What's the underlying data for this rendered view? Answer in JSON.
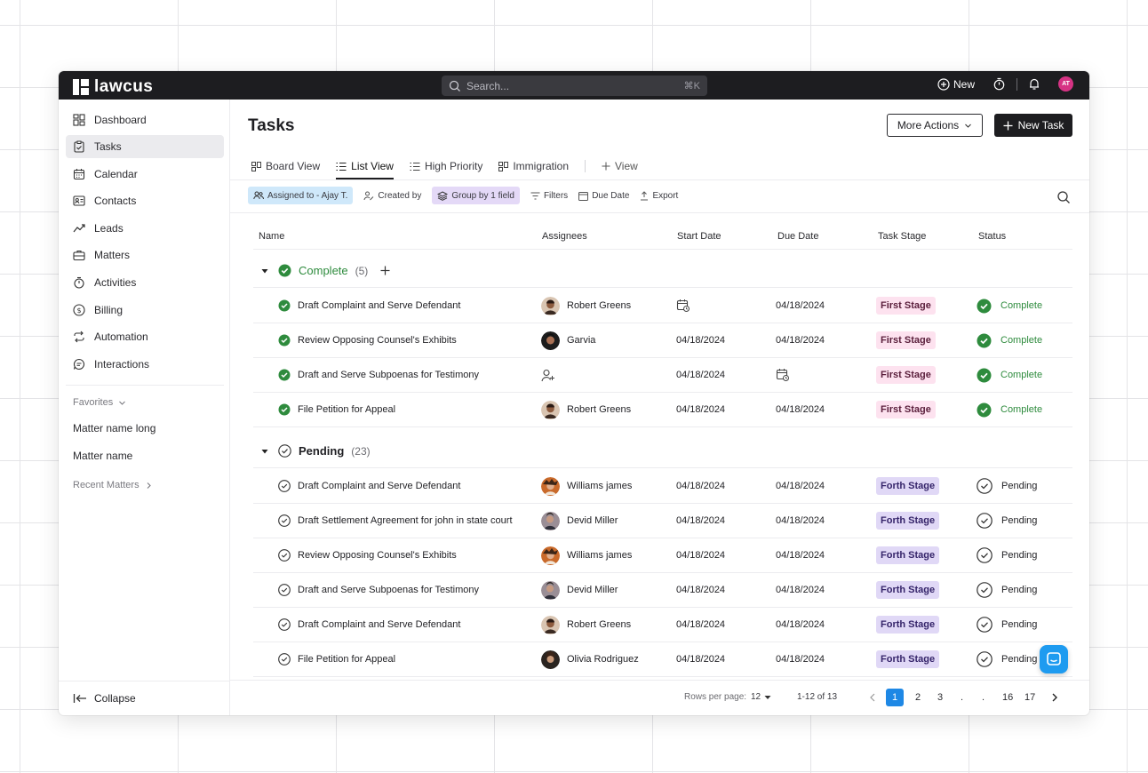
{
  "app": {
    "logo_text": "lawcus",
    "search_placeholder": "Search...",
    "search_shortcut": "⌘K",
    "new_label": "New",
    "avatar_initials": "AT"
  },
  "sidebar": {
    "items": [
      {
        "label": "Dashboard",
        "icon": "dashboard-icon"
      },
      {
        "label": "Tasks",
        "icon": "clipboard-icon"
      },
      {
        "label": "Calendar",
        "icon": "calendar-icon"
      },
      {
        "label": "Contacts",
        "icon": "contact-card-icon"
      },
      {
        "label": "Leads",
        "icon": "trend-icon"
      },
      {
        "label": "Matters",
        "icon": "briefcase-icon"
      },
      {
        "label": "Activities",
        "icon": "stopwatch-icon"
      },
      {
        "label": "Billing",
        "icon": "dollar-icon"
      },
      {
        "label": "Automation",
        "icon": "repeat-icon"
      },
      {
        "label": "Interactions",
        "icon": "message-icon"
      }
    ],
    "favorites_label": "Favorites",
    "favorites": [
      "Matter name long",
      "Matter name"
    ],
    "recent_label": "Recent Matters",
    "collapse_label": "Collapse"
  },
  "header": {
    "title": "Tasks",
    "more_actions": "More Actions",
    "new_task": "New Task"
  },
  "views": {
    "tabs": [
      "Board View",
      "List View",
      "High Priority",
      "Immigration"
    ],
    "add_view": "View"
  },
  "filters": {
    "assigned": "Assigned to - Ajay T.",
    "created_by": "Created by",
    "group_by": "Group by 1 field",
    "filters": "Filters",
    "due_date": "Due Date",
    "export": "Export"
  },
  "table": {
    "columns": [
      "Name",
      "Assignees",
      "Start Date",
      "Due Date",
      "Task Stage",
      "Status"
    ],
    "groups": [
      {
        "title": "Complete",
        "count": "(5)",
        "rows": [
          {
            "name": "Draft Complaint and Serve Defendant",
            "assignee": "Robert Greens",
            "start": "",
            "due": "04/18/2024",
            "stage": "First Stage",
            "status": "Complete"
          },
          {
            "name": "Review Opposing Counsel's Exhibits",
            "assignee": "Garvia",
            "start": "04/18/2024",
            "due": "04/18/2024",
            "stage": "First Stage",
            "status": "Complete"
          },
          {
            "name": "Draft and Serve Subpoenas for Testimony",
            "assignee": "",
            "start": "04/18/2024",
            "due": "",
            "stage": "First Stage",
            "status": "Complete"
          },
          {
            "name": "File Petition for Appeal",
            "assignee": "Robert Greens",
            "start": "04/18/2024",
            "due": "04/18/2024",
            "stage": "First Stage",
            "status": "Complete"
          }
        ]
      },
      {
        "title": "Pending",
        "count": "(23)",
        "rows": [
          {
            "name": "Draft Complaint and Serve Defendant",
            "assignee": "Williams james",
            "start": "04/18/2024",
            "due": "04/18/2024",
            "stage": "Forth Stage",
            "status": "Pending"
          },
          {
            "name": "Draft Settlement Agreement for john in state court",
            "assignee": "Devid Miller",
            "start": "04/18/2024",
            "due": "04/18/2024",
            "stage": "Forth Stage",
            "status": "Pending"
          },
          {
            "name": "Review Opposing Counsel's Exhibits",
            "assignee": "Williams james",
            "start": "04/18/2024",
            "due": "04/18/2024",
            "stage": "Forth Stage",
            "status": "Pending"
          },
          {
            "name": "Draft and Serve Subpoenas for Testimony",
            "assignee": "Devid Miller",
            "start": "04/18/2024",
            "due": "04/18/2024",
            "stage": "Forth Stage",
            "status": "Pending"
          },
          {
            "name": "Draft Complaint and Serve Defendant",
            "assignee": "Robert Greens",
            "start": "04/18/2024",
            "due": "04/18/2024",
            "stage": "Forth Stage",
            "status": "Pending"
          },
          {
            "name": "File Petition for Appeal",
            "assignee": "Olivia Rodriguez",
            "start": "04/18/2024",
            "due": "04/18/2024",
            "stage": "Forth Stage",
            "status": "Pending"
          }
        ]
      }
    ]
  },
  "pagination": {
    "rows_per_page_label": "Rows per page:",
    "rows_per_page": "12",
    "range": "1-12 of 13",
    "pages": [
      "1",
      "2",
      "3",
      ".",
      ".",
      "16",
      "17"
    ]
  },
  "colors": {
    "complete_green": "#2e8b3d",
    "first_stage_bg": "#fde2ef",
    "forth_stage_bg": "#e0d8f6",
    "accent_blue": "#1e88e5",
    "topbar": "#1d1d20"
  }
}
